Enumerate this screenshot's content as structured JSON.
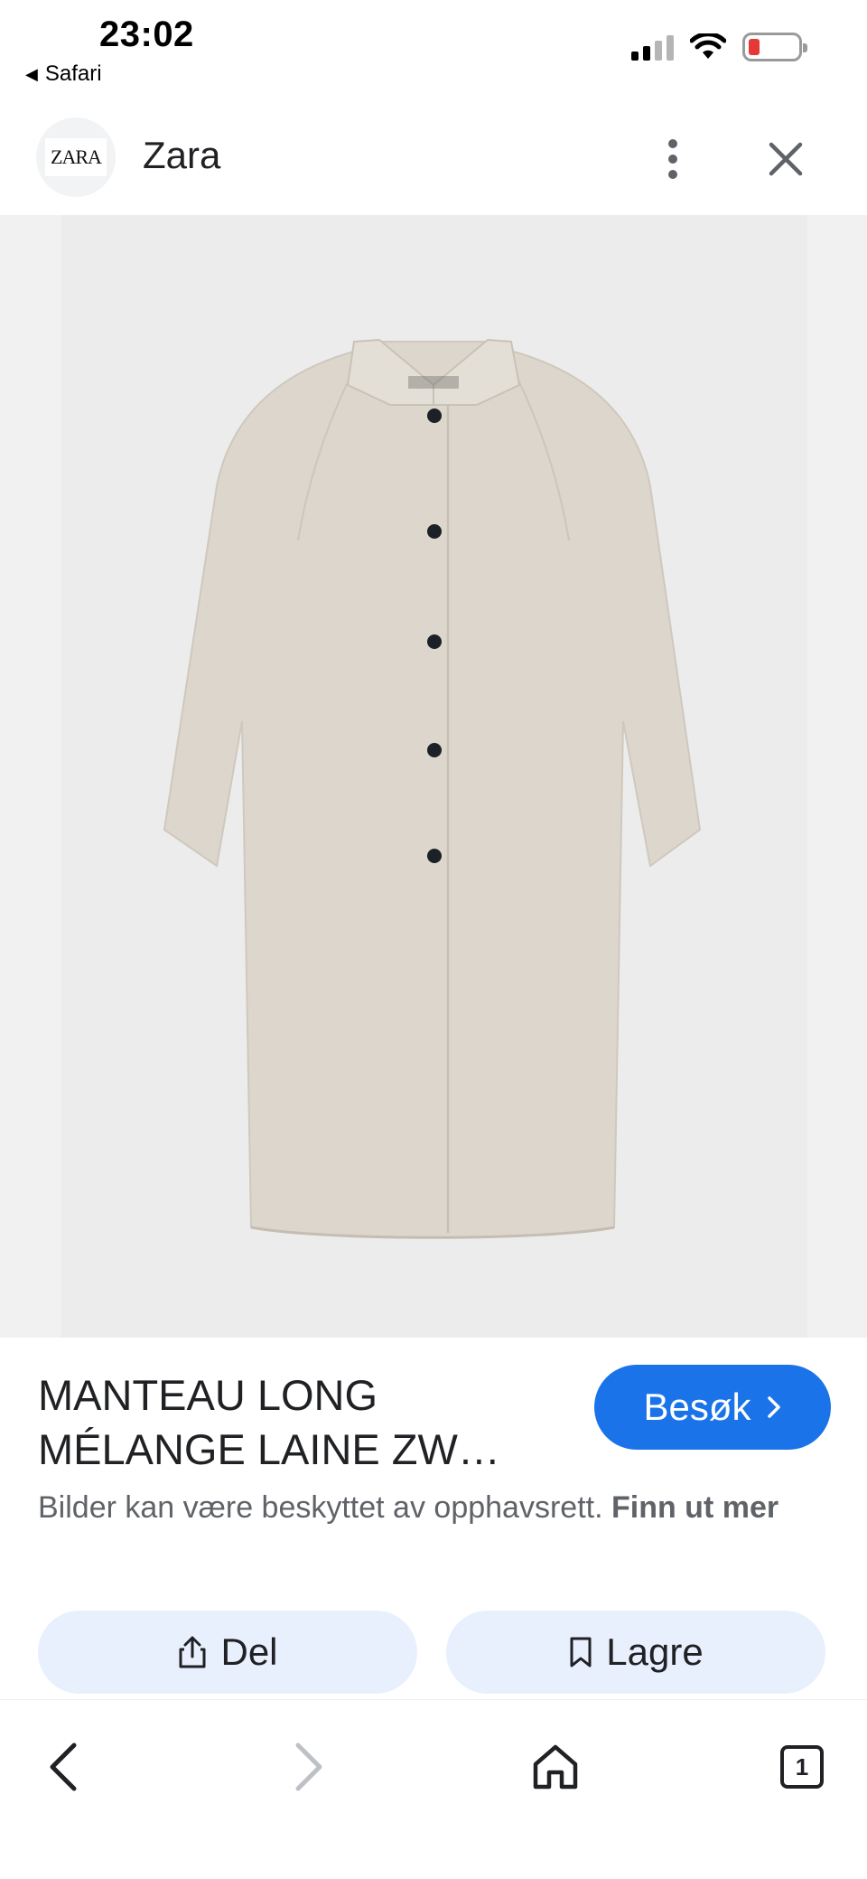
{
  "status_bar": {
    "time": "23:02",
    "back_app_label": "Safari",
    "battery_color": "#e53935"
  },
  "header": {
    "logo_text": "ZARA",
    "site_name": "Zara",
    "more_icon": "more-vert-icon",
    "close_icon": "close-icon"
  },
  "product": {
    "image_description_icon": "coat-image",
    "title_line1": "MANTEAU LONG",
    "title_line2": "MÉLANGE LAINE ZW…",
    "visit_label": "Besøk",
    "visit_icon": "chevron-right-icon",
    "accent_color": "#1a73e8"
  },
  "copyright": {
    "text": "Bilder kan være beskyttet av opphavsrett.",
    "learn_more": "Finn ut mer"
  },
  "actions": {
    "share_label": "Del",
    "save_label": "Lagre"
  },
  "bottom_nav": {
    "tab_count": "1"
  }
}
